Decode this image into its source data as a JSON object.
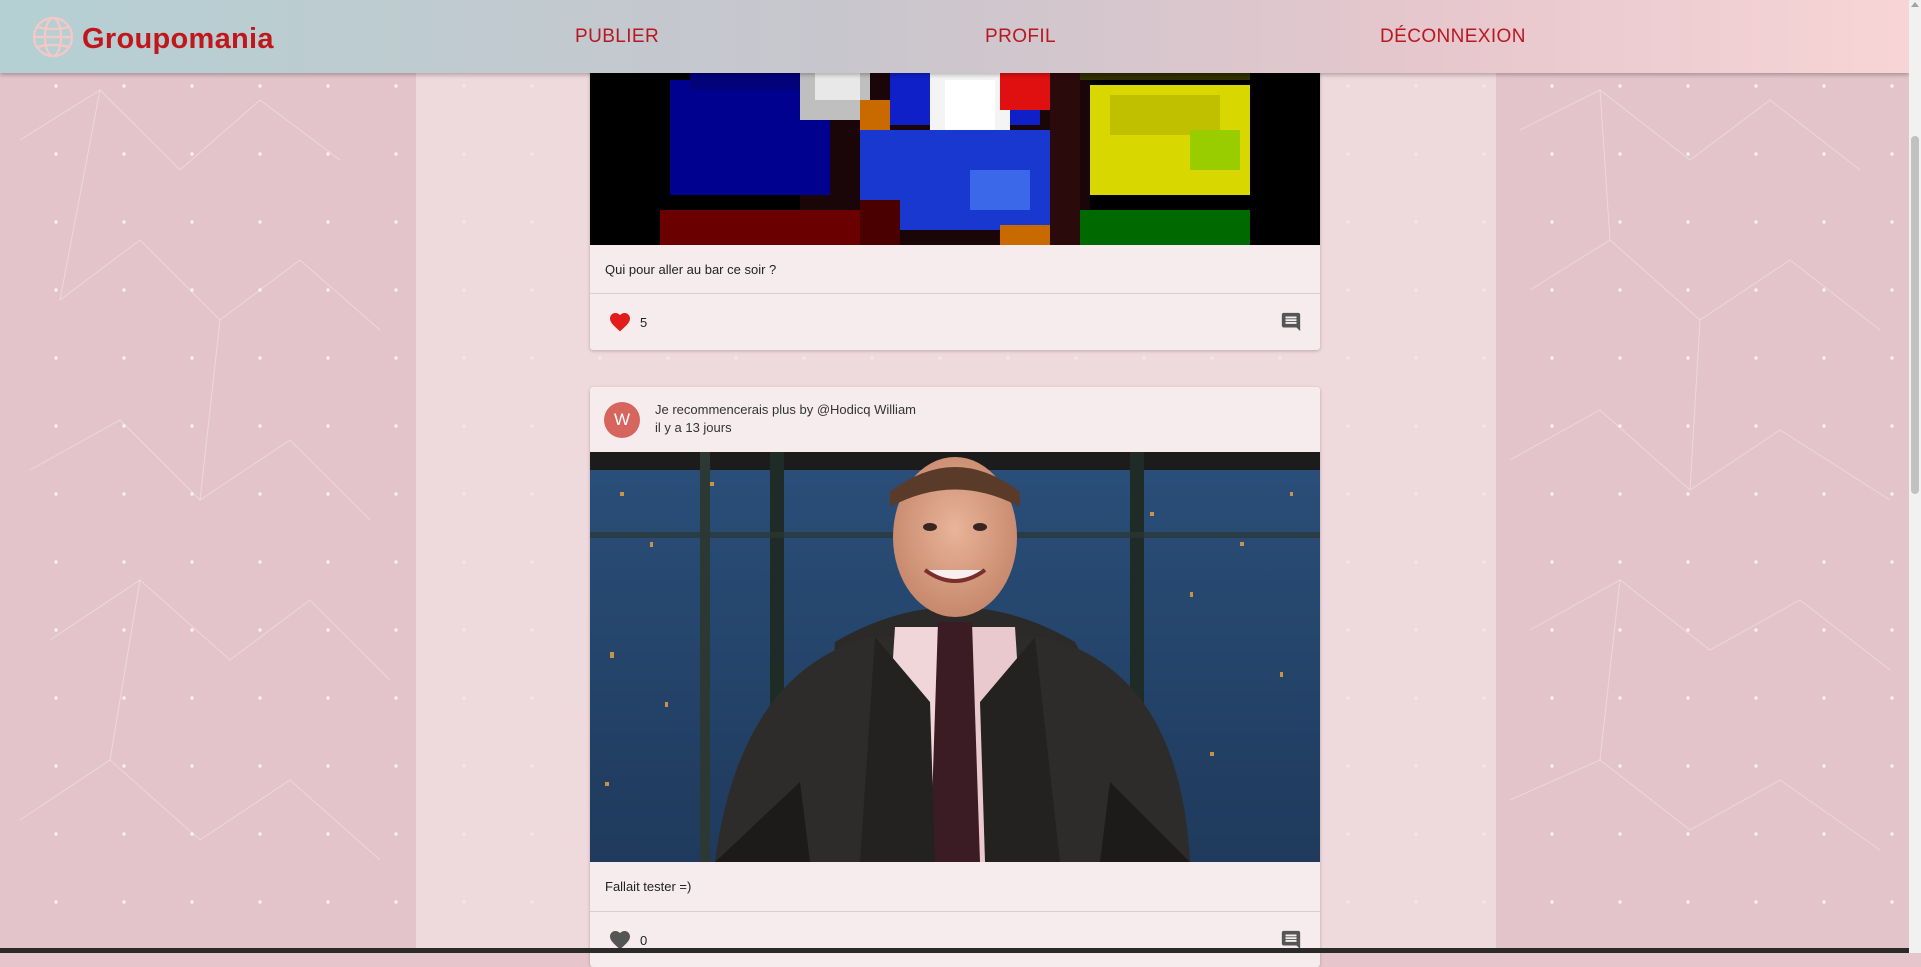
{
  "app": {
    "name": "Groupomania",
    "brand_color": "#c0171c",
    "logo_icon": "globe-icon"
  },
  "nav": {
    "items": [
      {
        "label": "PUBLIER"
      },
      {
        "label": "PROFIL"
      },
      {
        "label": "DÉCONNEXION"
      }
    ]
  },
  "posts": [
    {
      "caption": "Qui pour aller au bar ce soir ?",
      "likes": "5",
      "liked": true,
      "like_icon": "heart-icon",
      "comment_icon": "comment-icon"
    },
    {
      "avatar_letter": "W",
      "avatar_color": "#d6655e",
      "title": "Je recommencerais plus by @Hodicq William",
      "time": "il y a 13 jours",
      "caption": "Fallait tester =)",
      "likes": "0",
      "liked": false,
      "like_icon": "heart-icon",
      "comment_icon": "comment-icon"
    }
  ]
}
